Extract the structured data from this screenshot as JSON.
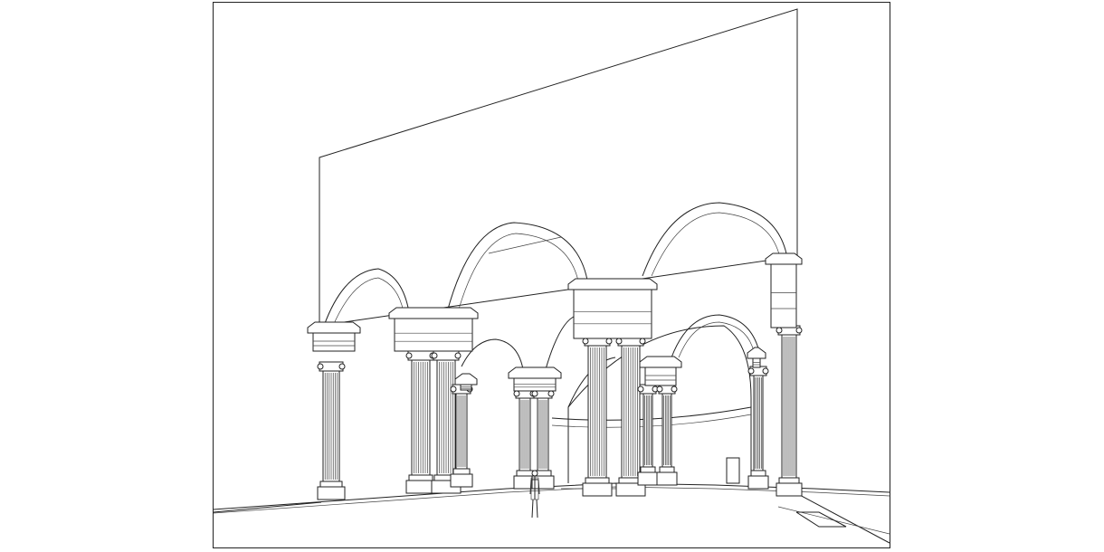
{
  "drawing": {
    "kind": "architectural-perspective-wireframe",
    "subject": "colonnade-with-arches",
    "line_color": "#222222",
    "background_color": "#ffffff"
  }
}
